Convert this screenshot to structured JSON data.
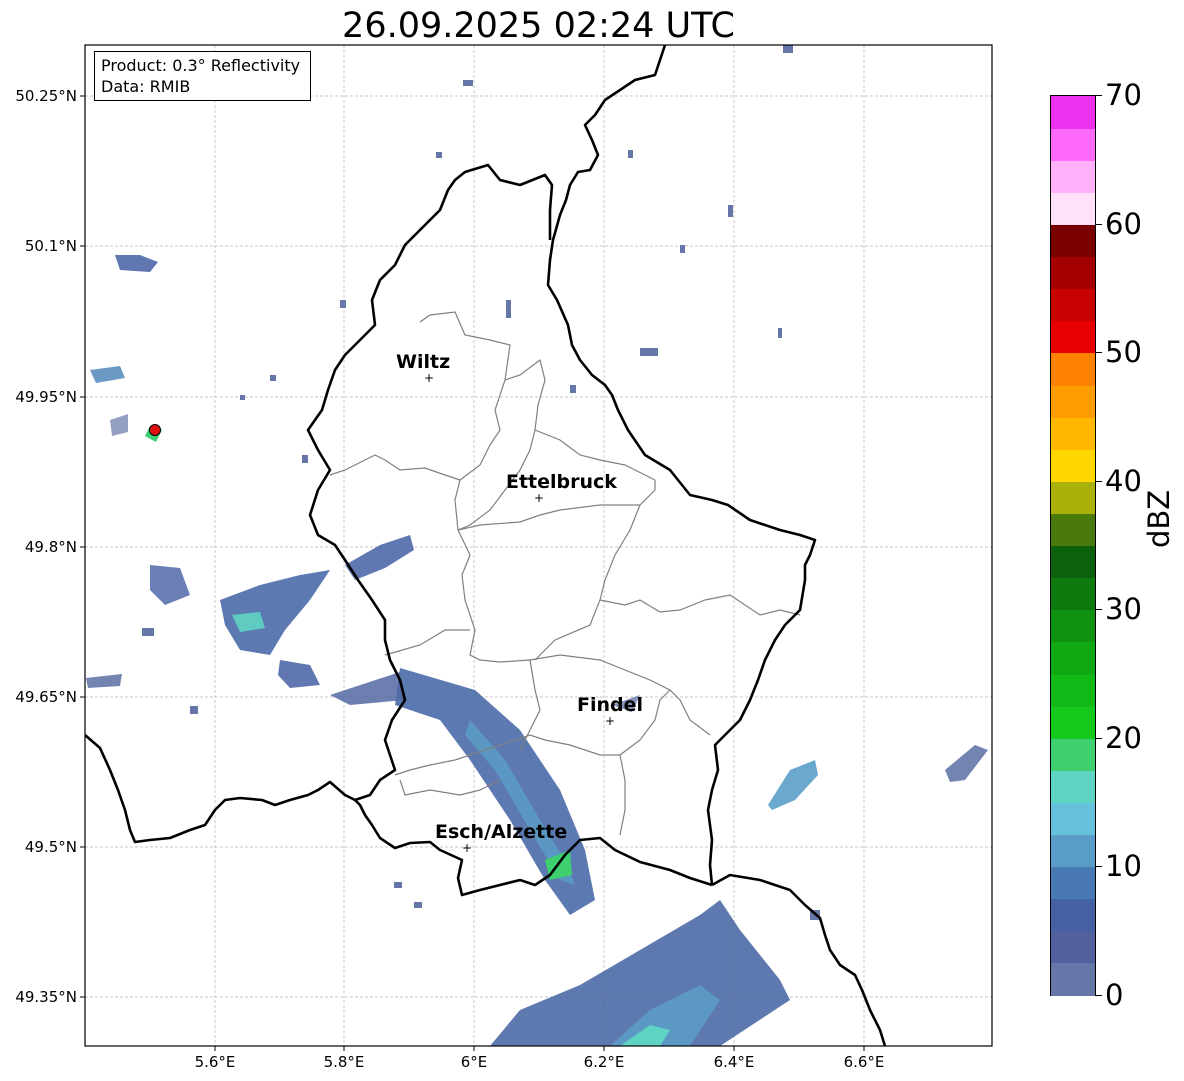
{
  "title": "26.09.2025 02:24 UTC",
  "info": {
    "product": "Product: 0.3° Reflectivity",
    "data_source": "Data: RMIB"
  },
  "axes": {
    "lon_ticks": [
      "5.6°E",
      "5.8°E",
      "6°E",
      "6.2°E",
      "6.4°E",
      "6.6°E"
    ],
    "lat_ticks": [
      "50.25°N",
      "50.1°N",
      "49.95°N",
      "49.8°N",
      "49.65°N",
      "49.5°N",
      "49.35°N"
    ],
    "lon_range": [
      5.4,
      6.8
    ],
    "lat_range": [
      49.3,
      50.3
    ]
  },
  "cities": [
    {
      "name": "Wiltz",
      "lon": 5.93,
      "lat": 49.97
    },
    {
      "name": "Ettelbruck",
      "lon": 6.1,
      "lat": 49.85
    },
    {
      "name": "Findel",
      "lon": 6.21,
      "lat": 49.63
    },
    {
      "name": "Esch/Alzette",
      "lon": 5.99,
      "lat": 49.5
    }
  ],
  "radar_marker": {
    "lon": 5.51,
    "lat": 49.917,
    "color": "#e01010"
  },
  "colorbar": {
    "label": "dBZ",
    "ticks": [
      "0",
      "10",
      "20",
      "30",
      "40",
      "50",
      "60",
      "70"
    ],
    "colors": [
      "#6577a8",
      "#52619e",
      "#4361a3",
      "#4979b3",
      "#5a9cc8",
      "#66c2dc",
      "#5fd4c3",
      "#3ecf6f",
      "#15c81c",
      "#12b816",
      "#10a813",
      "#0f920f",
      "#0d7a0e",
      "#0b610c",
      "#4a7a0c",
      "#aab10a",
      "#ffd600",
      "#ffb700",
      "#ff9d00",
      "#ff8100",
      "#e70000",
      "#c90000",
      "#a50000",
      "#7a0000",
      "#ffe1fa",
      "#ffb2fa",
      "#ff6afb",
      "#ee31ee"
    ]
  }
}
